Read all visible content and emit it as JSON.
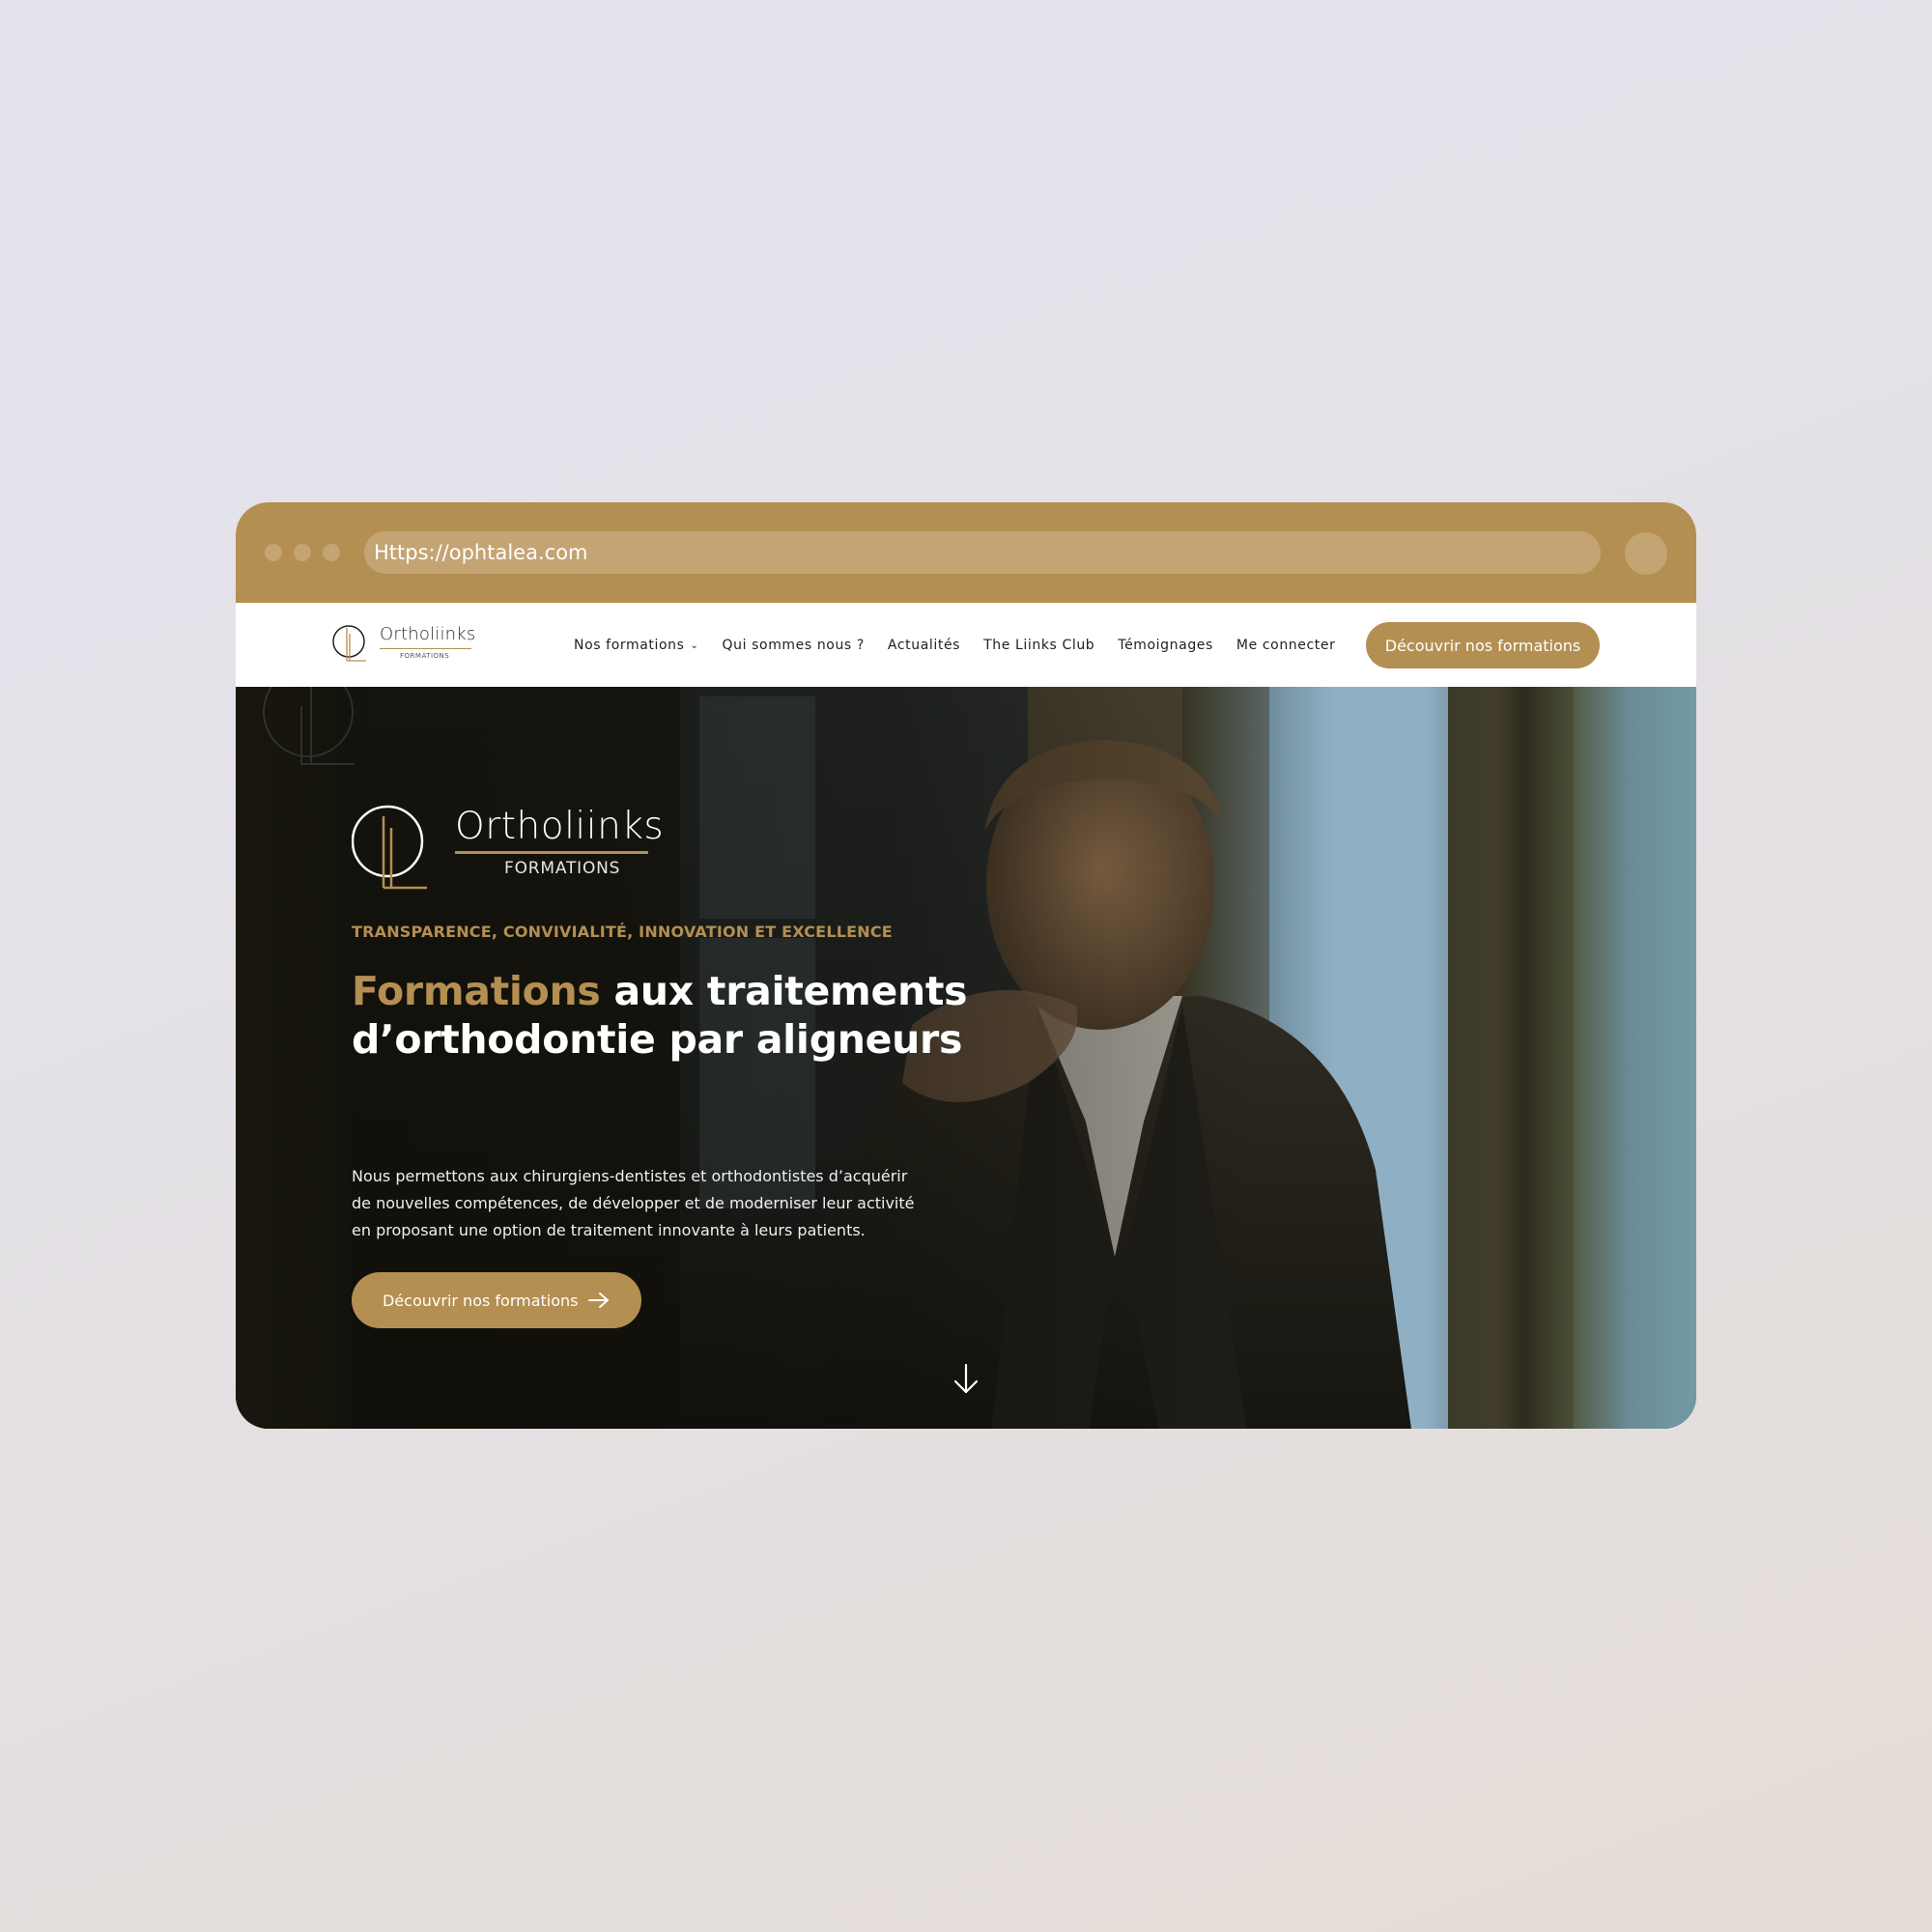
{
  "browser": {
    "url": "Https://ophtalea.com",
    "window_dots": [
      "dot-1",
      "dot-2",
      "dot-3"
    ],
    "accent_color": "#B48F52"
  },
  "nav": {
    "logo": {
      "brand": "Ortholiinks",
      "sub": "FORMATIONS"
    },
    "items": [
      {
        "label": "Nos formations",
        "has_dropdown": true,
        "icon": "chevron-down-icon"
      },
      {
        "label": "Qui sommes nous ?"
      },
      {
        "label": "Actualités"
      },
      {
        "label": "The Liinks Club"
      },
      {
        "label": "Témoignages"
      },
      {
        "label": "Me connecter"
      }
    ],
    "cta_label": "Découvrir nos formations"
  },
  "hero": {
    "logo": {
      "brand": "Ortholiinks",
      "sub": "FORMATIONS"
    },
    "tagline": "TRANSPARENCE, CONVIVIALITÉ, INNOVATION ET EXCELLENCE",
    "headline_accent": "Formations",
    "headline_rest": " aux traitements d’orthodontie par aligneurs",
    "description": "Nous permettons aux chirurgiens-dentistes et orthodontistes d’acquérir de nouvelles compétences, de développer et de moderniser leur activité en proposant une option de traitement innovante à leurs patients.",
    "cta_label": "Découvrir nos formations",
    "cta_icon": "arrow-right-icon",
    "scroll_icon": "arrow-down-icon"
  }
}
